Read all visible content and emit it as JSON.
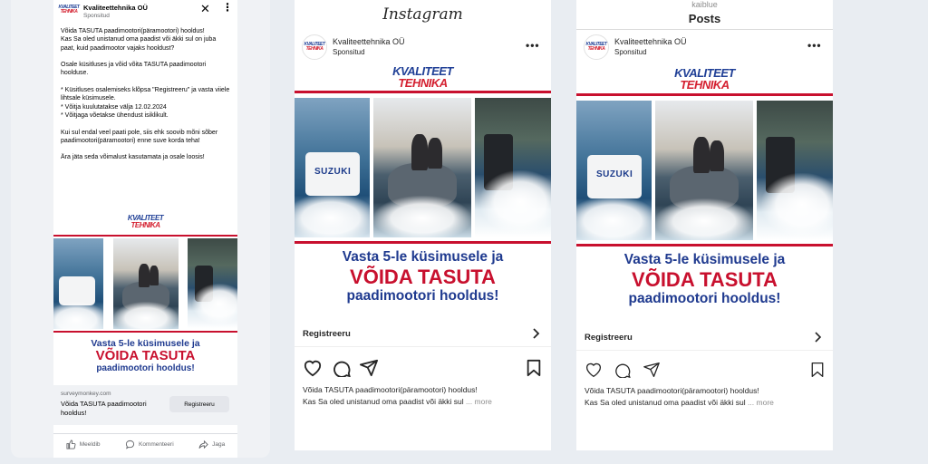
{
  "colors": {
    "brand_blue": "#1f3a8f",
    "brand_red": "#c8102e",
    "fb_background": "#f0f2f5",
    "page_background": "#e9edf2"
  },
  "brand": {
    "line1": "KVALITEET",
    "line2": "TEHNIKA"
  },
  "creative": {
    "headline_line1": "Vasta 5-le küsimusele ja",
    "headline_line2": "VÕIDA TASUTA",
    "headline_line3": "paadimootori hooldus!",
    "motor_label": "SUZUKI"
  },
  "facebook": {
    "page_name": "Kvaliteettehnika OÜ",
    "sponsored": "Sponsitud",
    "close_icon": "close-icon",
    "more_icon": "more-vertical-icon",
    "post_text": "Võida TASUTA paadimootori(päramootori) hooldus!\nKas Sa oled unistanud oma paadist või äkki sul on juba paat, kuid paadimootor vajaks hooldust?\n\nOsale küsitluses ja võid võita TASUTA paadimootori hoolduse.\n\n* Küsitluses osalemiseks klõpsa \"Registreeru\" ja vasta viiele lihtsale küsimusele.\n* Võitja kuulutatakse välja 12.02.2024\n* Võitjaga võetakse ühendust isiklikult.\n\nKui sul endal veel paati pole, siis ehk soovib mõni sõber paadimootori(päramootori) enne suve korda teha!\n\nÄra jäta seda võimalust kasutamata ja osale loosis!",
    "link_domain": "surveymonkey.com",
    "link_title": "Võida TASUTA paadimootori hooldus!",
    "cta_button": "Registreeru",
    "actions": [
      {
        "label": "Meeldib",
        "icon": "thumbs-up-icon"
      },
      {
        "label": "Kommenteeri",
        "icon": "comment-icon"
      },
      {
        "label": "Jaga",
        "icon": "share-icon"
      }
    ]
  },
  "instagram_feed": {
    "app_title": "Instagram",
    "page_name": "Kvaliteettehnika OÜ",
    "sponsored": "Sponsitud",
    "cta_label": "Registreeru",
    "caption_line1": "Võida TASUTA paadimootori(päramootori) hooldus!",
    "caption_line2": "Kas Sa oled unistanud oma paadist või äkki sul",
    "caption_ellipsis": "...",
    "more_label": "more",
    "icons": [
      "heart-icon",
      "comment-icon",
      "send-icon",
      "bookmark-icon"
    ]
  },
  "instagram_profile": {
    "username": "kaiblue",
    "header_title": "Posts",
    "page_name": "Kvaliteettehnika OÜ",
    "sponsored": "Sponsitud",
    "cta_label": "Registreeru",
    "caption_line1": "Võida TASUTA paadimootori(päramootori) hooldus!",
    "caption_line2": "Kas Sa oled unistanud oma paadist või äkki sul",
    "caption_ellipsis": "...",
    "more_label": "more",
    "icons": [
      "heart-icon",
      "comment-icon",
      "send-icon",
      "bookmark-icon"
    ]
  }
}
